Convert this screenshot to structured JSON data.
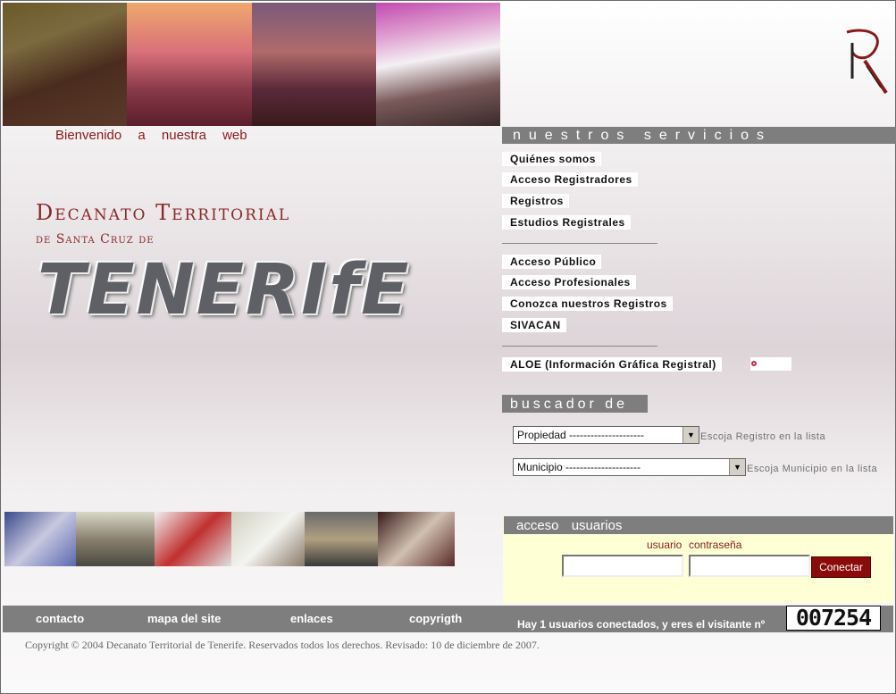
{
  "header": {
    "welcome": "Bienvenido a nuestra web"
  },
  "logo": {
    "line1": "Decanato Territorial",
    "line2": "de Santa Cruz de",
    "line3": "TENERIfE"
  },
  "servicios": {
    "title": "nuestros servicios",
    "group1": [
      "Quiénes somos",
      "Acceso Registradores",
      "Registros",
      "Estudios Registrales"
    ],
    "group2": [
      "Acceso Público",
      "Acceso Profesionales",
      "Conozca nuestros Registros",
      "SIVACAN"
    ],
    "aloe": "ALOE (Información Gráfica Registral)"
  },
  "buscador": {
    "title": "buscador de",
    "select1": {
      "value": "Propiedad ---------------------",
      "hint": "Escoja Registro en la lista"
    },
    "select2": {
      "value": "Municipio ---------------------",
      "hint": "Escoja Municipio en la lista"
    }
  },
  "login": {
    "title": "acceso usuarios",
    "user_label": "usuario",
    "pass_label": "contraseña",
    "button": "Conectar"
  },
  "footer": {
    "links": [
      "contacto",
      "mapa del site",
      "enlaces",
      "copyrigth"
    ],
    "status": "Hay 1 usuarios conectados, y eres el visitante nº",
    "counter": "007254",
    "copyright": "Copyright © 2004 Decanato Territorial de Tenerife. Reservados todos los derechos. Revisado: 10 de diciembre de 2007."
  },
  "colors": {
    "accent": "#8b1a1a",
    "bar": "#7e7e7e",
    "login_bg": "#ffffd6"
  }
}
